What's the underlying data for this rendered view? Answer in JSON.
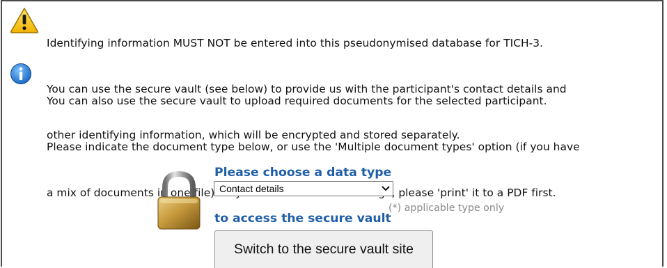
{
  "warning": {
    "icon": "warning-triangle-icon",
    "lines": [
      "Identifying information MUST NOT be entered into this pseudonymised database for TICH-3.",
      "You can use the secure vault (see below) to provide us with the participant's contact details and",
      "other identifying information, which will be encrypted and stored separately."
    ]
  },
  "info": {
    "icon": "info-circle-icon",
    "lines": [
      "You can also use the secure vault to upload required documents for the selected participant.",
      "Please indicate the document type below, or use the 'Multiple document types' option (if you have",
      "a mix of documents in one file).  If your file isn't a PDF or image, please 'print' it to a PDF first."
    ]
  },
  "vault": {
    "heading_lines": [
      "Please choose a data type",
      "to access the secure vault"
    ],
    "lock_icon": "padlock-icon",
    "select_value": "Contact details",
    "hint": "(*) applicable type only",
    "button_label": "Switch to the secure vault site"
  },
  "colors": {
    "heading": "#1f5ea8",
    "hint": "#8a8a8a",
    "button_bg": "#efefef",
    "frame_border": "#4a4a4a"
  }
}
